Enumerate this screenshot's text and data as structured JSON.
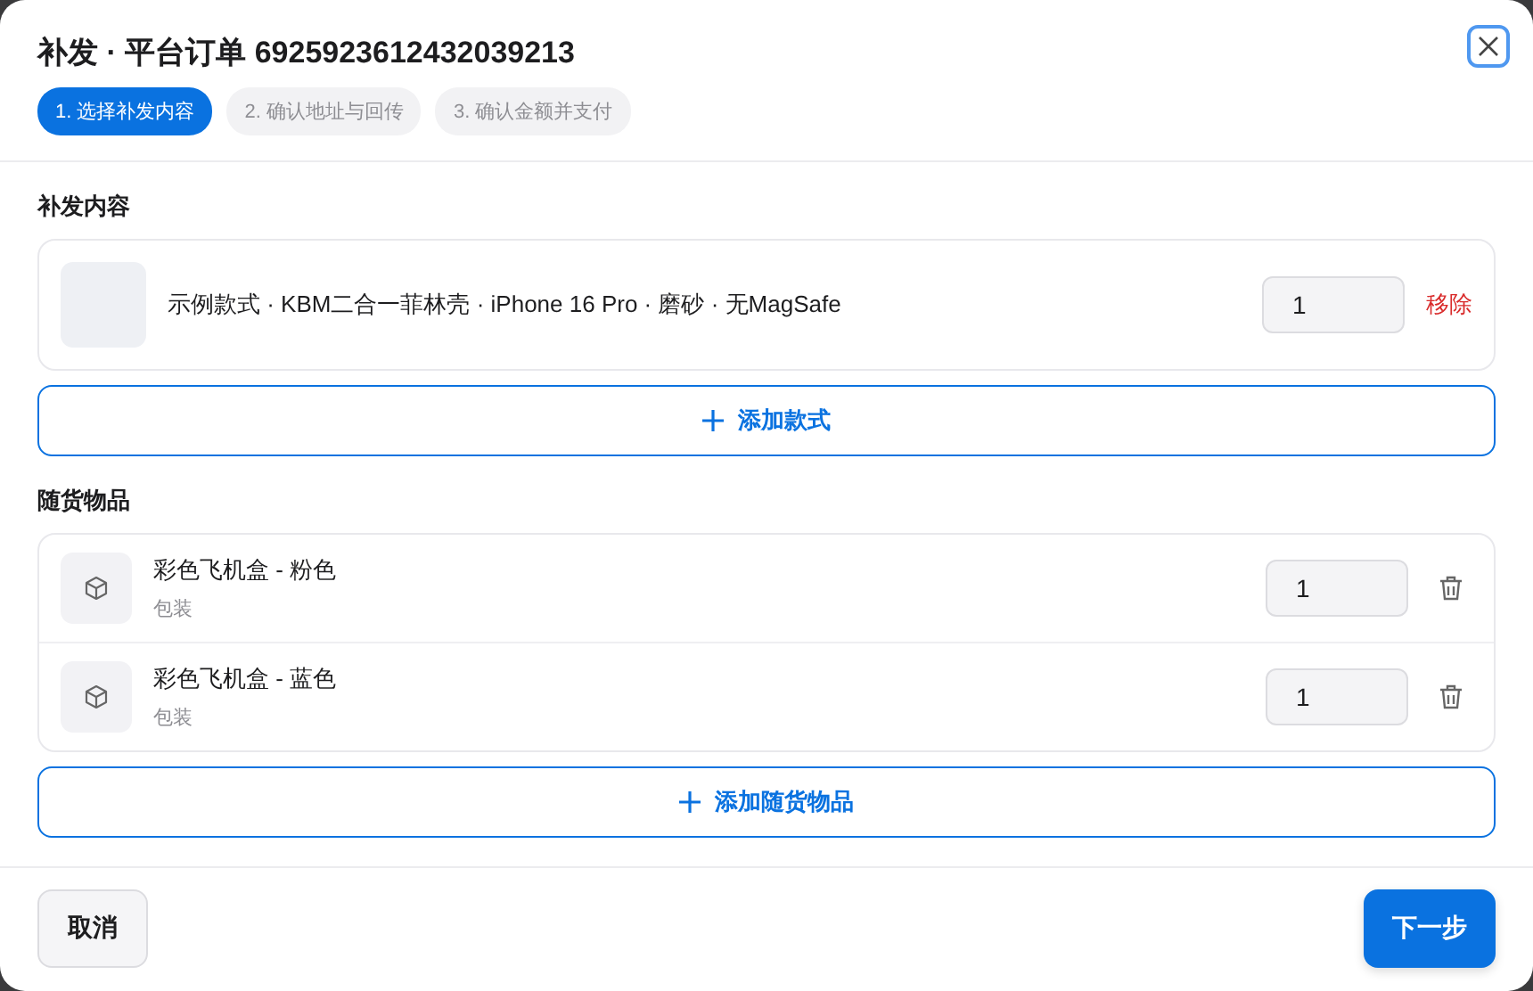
{
  "dialog": {
    "title": "补发 · 平台订单 6925923612432039213"
  },
  "steps": [
    {
      "label": "1. 选择补发内容",
      "selected": true
    },
    {
      "label": "2. 确认地址与回传",
      "selected": false
    },
    {
      "label": "3. 确认金额并支付",
      "selected": false
    }
  ],
  "reship_section": {
    "heading": "补发内容",
    "items": [
      {
        "name": "示例款式 · KBM二合一菲林壳 · iPhone 16 Pro · 磨砂 · 无MagSafe",
        "quantity": "1",
        "remove_label": "移除"
      }
    ],
    "add_button": "添加款式"
  },
  "accessories_section": {
    "heading": "随货物品",
    "items": [
      {
        "name": "彩色飞机盒 - 粉色",
        "category": "包装",
        "quantity": "1"
      },
      {
        "name": "彩色飞机盒 - 蓝色",
        "category": "包装",
        "quantity": "1"
      }
    ],
    "add_button": "添加随货物品"
  },
  "footer": {
    "cancel": "取消",
    "next": "下一步"
  }
}
